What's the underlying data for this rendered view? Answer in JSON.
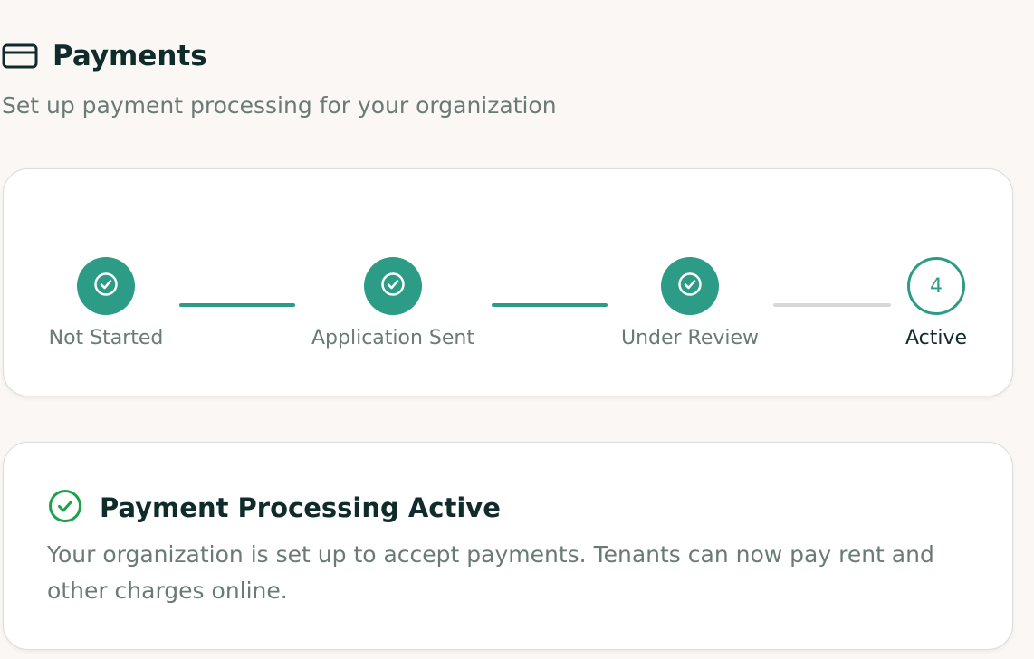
{
  "header": {
    "title": "Payments",
    "subtitle": "Set up payment processing for your organization",
    "icon": "credit-card-icon"
  },
  "stepper": {
    "steps": [
      {
        "label": "Not Started",
        "state": "complete",
        "icon": "check-circle-icon"
      },
      {
        "label": "Application Sent",
        "state": "complete",
        "icon": "check-circle-icon"
      },
      {
        "label": "Under Review",
        "state": "complete",
        "icon": "check-circle-icon"
      },
      {
        "label": "Active",
        "state": "current",
        "number": "4"
      }
    ]
  },
  "status": {
    "icon": "check-circle-icon",
    "title": "Payment Processing Active",
    "description": "Your organization is set up to accept payments. Tenants can now pay rent and other charges online."
  },
  "colors": {
    "accent": "#2c9c87",
    "success": "#1aa34a",
    "background": "#faf7f4",
    "text_primary": "#0f2b2a",
    "text_muted": "#6a7a76",
    "connector_pending": "#d8d8d4"
  }
}
